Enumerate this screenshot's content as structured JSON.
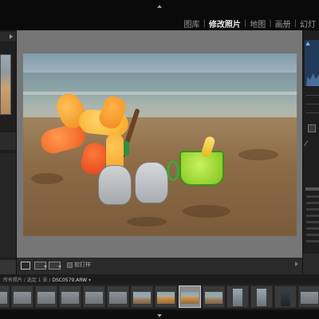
{
  "modules": {
    "items": [
      {
        "label": "图库",
        "active": false
      },
      {
        "label": "修改照片",
        "active": true
      },
      {
        "label": "地图",
        "active": false
      },
      {
        "label": "画册",
        "active": false
      },
      {
        "label": "幻灯",
        "active": false
      }
    ],
    "separator": "|"
  },
  "toolbar": {
    "softproof_label": "软打样"
  },
  "filmstrip": {
    "path_label": "所有照片 / 选定 1 张 /",
    "filename": "DSC0579.ARW",
    "caret": "▾",
    "selected_index": 8,
    "frames": [
      {
        "num": "",
        "kind": "gray"
      },
      {
        "num": "",
        "kind": "gray"
      },
      {
        "num": "",
        "kind": "gray"
      },
      {
        "num": "",
        "kind": "gray"
      },
      {
        "num": "",
        "kind": "gray"
      },
      {
        "num": "",
        "kind": "gray"
      },
      {
        "num": "",
        "kind": "beach"
      },
      {
        "num": "",
        "kind": "beach-color"
      },
      {
        "num": "",
        "kind": "beach-color"
      },
      {
        "num": "",
        "kind": "beach"
      },
      {
        "num": "",
        "kind": "portrait"
      },
      {
        "num": "",
        "kind": "portrait"
      },
      {
        "num": "",
        "kind": "portrait-dark"
      },
      {
        "num": "",
        "kind": "gray"
      }
    ]
  },
  "colors": {
    "background": "#111111",
    "workspace": "#767676",
    "accent_histogram": "#223a5a"
  }
}
